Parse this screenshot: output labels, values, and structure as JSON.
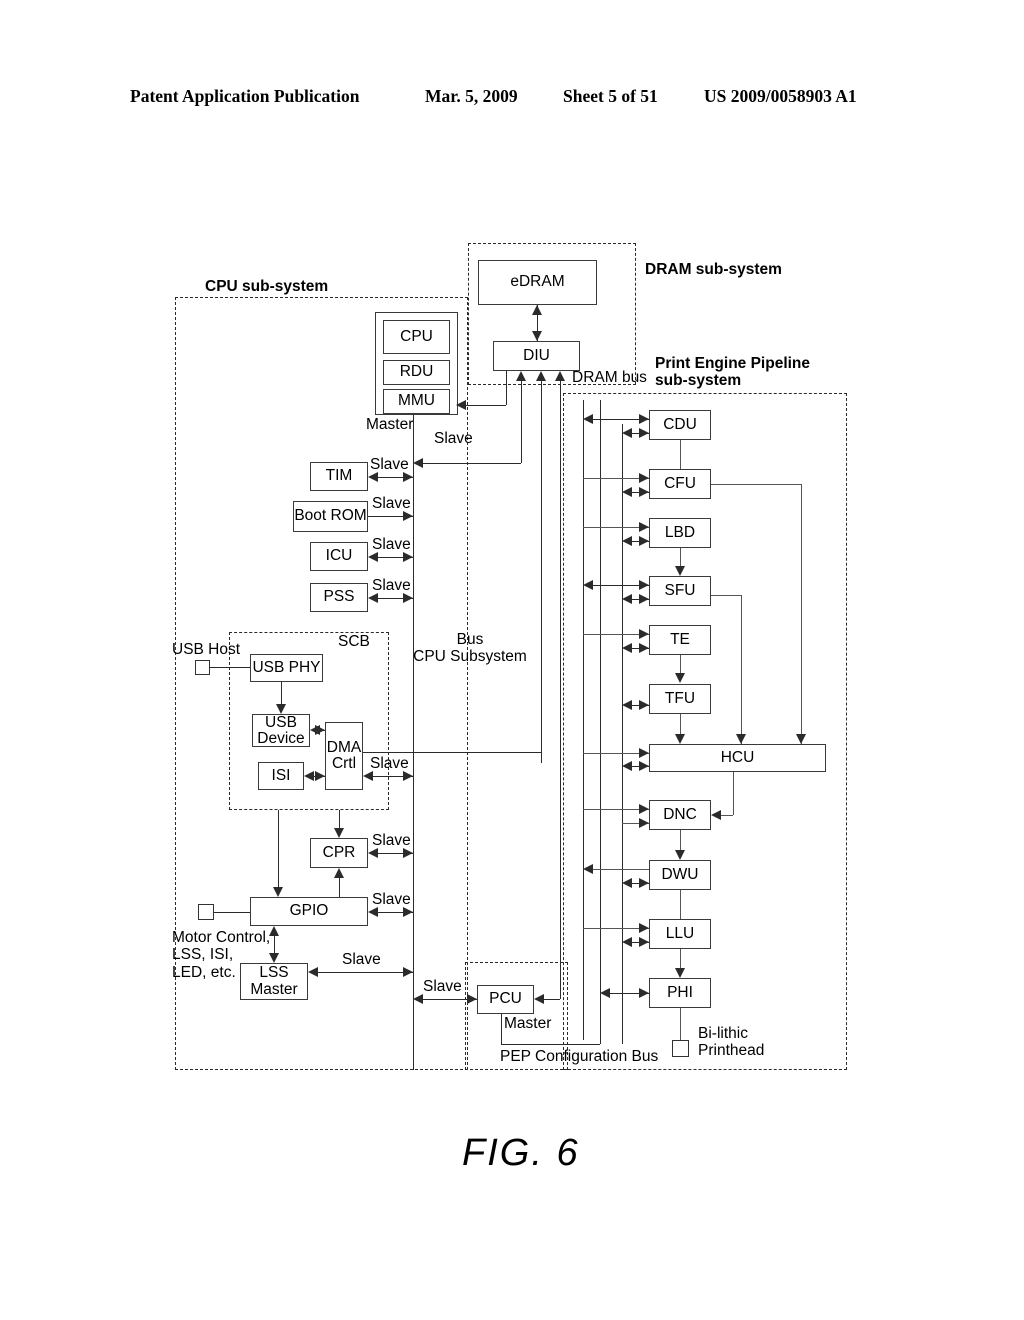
{
  "header": {
    "publication": "Patent Application Publication",
    "date": "Mar. 5, 2009",
    "sheet": "Sheet 5 of 51",
    "number": "US 2009/0058903 A1"
  },
  "figure": {
    "caption": "FIG. 6",
    "subsystems": [
      {
        "id": "cpu",
        "label": "CPU sub-system"
      },
      {
        "id": "dram",
        "label": "DRAM sub-system"
      },
      {
        "id": "pep",
        "label": "Print Engine Pipeline\nsub-system"
      },
      {
        "id": "scb",
        "label": "SCB"
      },
      {
        "id": "pepcfg",
        "label": "PEP Configuration Bus"
      }
    ],
    "blocks": [
      {
        "id": "cpu",
        "label": "CPU"
      },
      {
        "id": "rdu",
        "label": "RDU"
      },
      {
        "id": "mmu",
        "label": "MMU"
      },
      {
        "id": "edram",
        "label": "eDRAM"
      },
      {
        "id": "diu",
        "label": "DIU"
      },
      {
        "id": "tim",
        "label": "TIM"
      },
      {
        "id": "bootrom",
        "label": "Boot ROM"
      },
      {
        "id": "icu",
        "label": "ICU"
      },
      {
        "id": "pss",
        "label": "PSS"
      },
      {
        "id": "usbphy",
        "label": "USB PHY"
      },
      {
        "id": "usbdevice",
        "label": "USB\nDevice"
      },
      {
        "id": "isi",
        "label": "ISI"
      },
      {
        "id": "dmactrl",
        "label": "DMA\nCrtl"
      },
      {
        "id": "cpr",
        "label": "CPR"
      },
      {
        "id": "gpio",
        "label": "GPIO"
      },
      {
        "id": "lssmaster",
        "label": "LSS\nMaster"
      },
      {
        "id": "pcu",
        "label": "PCU"
      },
      {
        "id": "cdu",
        "label": "CDU"
      },
      {
        "id": "cfu",
        "label": "CFU"
      },
      {
        "id": "lbd",
        "label": "LBD"
      },
      {
        "id": "sfu",
        "label": "SFU"
      },
      {
        "id": "te",
        "label": "TE"
      },
      {
        "id": "tfu",
        "label": "TFU"
      },
      {
        "id": "hcu",
        "label": "HCU"
      },
      {
        "id": "dnc",
        "label": "DNC"
      },
      {
        "id": "dwu",
        "label": "DWU"
      },
      {
        "id": "llu",
        "label": "LLU"
      },
      {
        "id": "phi",
        "label": "PHI"
      }
    ],
    "annotations": {
      "master_cpu": "Master",
      "slave_diu": "Slave",
      "slave_tim": "Slave",
      "slave_bootrom": "Slave",
      "slave_icu": "Slave",
      "slave_pss": "Slave",
      "slave_dma": "Slave",
      "slave_cpr": "Slave",
      "slave_gpio": "Slave",
      "slave_lss": "Slave",
      "slave_pcu": "Slave",
      "master_pcu": "Master",
      "dram_bus": "DRAM bus",
      "bus_cpu_subsystem": "Bus\nCPU Subsystem",
      "usb_host": "USB Host",
      "motor_control": "Motor Control,\nLSS, ISI,\nLED, etc.",
      "bilithic_printhead": "Bi-lithic\nPrinthead"
    }
  }
}
